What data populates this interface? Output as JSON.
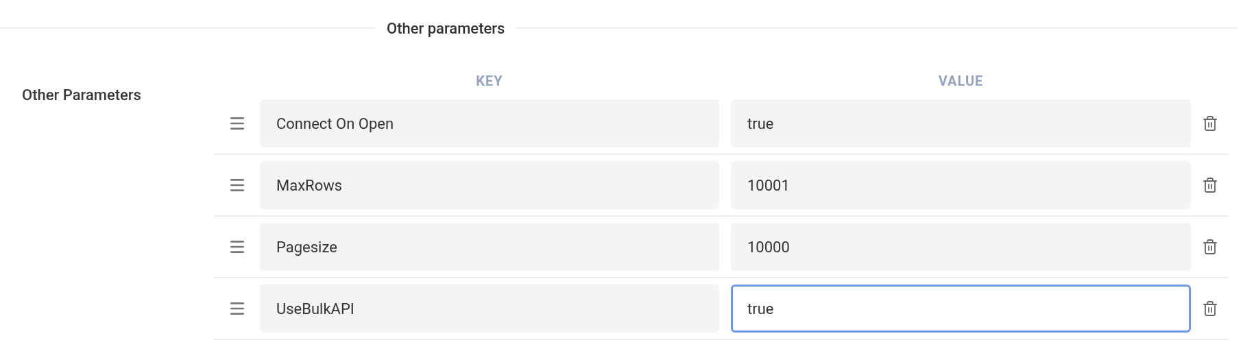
{
  "section": {
    "legend": "Other parameters",
    "label": "Other Parameters"
  },
  "columns": [
    "KEY",
    "VALUE"
  ],
  "rows": [
    {
      "key": "Connect On Open",
      "value": "true",
      "focused": false
    },
    {
      "key": "MaxRows",
      "value": "10001",
      "focused": false
    },
    {
      "key": "Pagesize",
      "value": "10000",
      "focused": false
    },
    {
      "key": "UseBulkAPI",
      "value": "true",
      "focused": true
    }
  ]
}
